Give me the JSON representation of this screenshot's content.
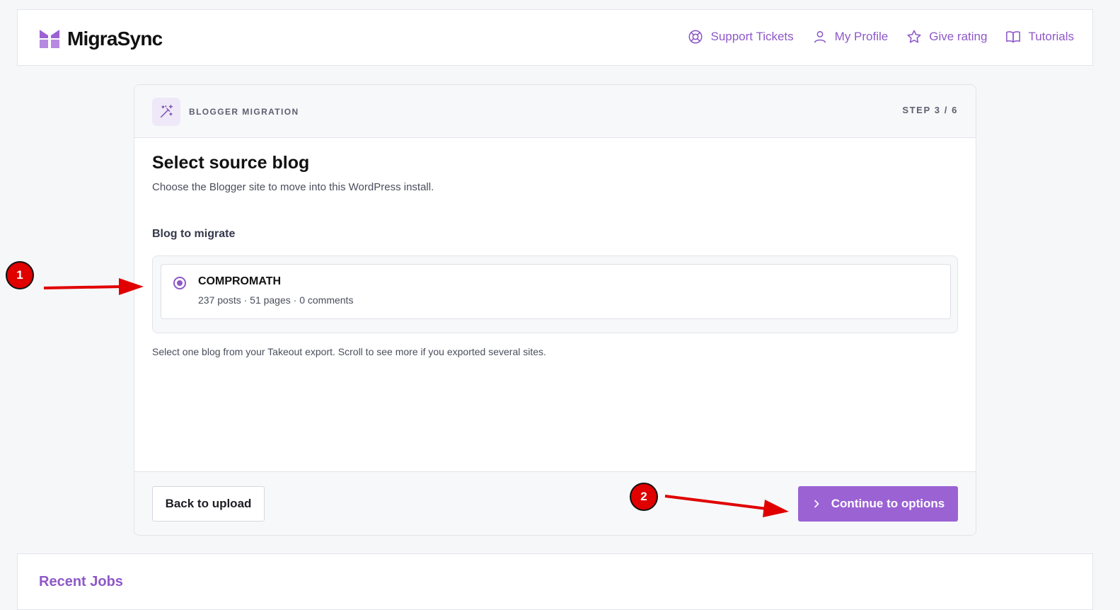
{
  "app": {
    "name": "MigraSync",
    "brand_color": "#8e58c8"
  },
  "nav": {
    "items": [
      {
        "label": "Support Tickets",
        "icon": "lifebuoy-icon"
      },
      {
        "label": "My Profile",
        "icon": "user-icon"
      },
      {
        "label": "Give rating",
        "icon": "star-icon"
      },
      {
        "label": "Tutorials",
        "icon": "book-icon"
      }
    ]
  },
  "wizard": {
    "section_label": "BLOGGER MIGRATION",
    "step": "STEP  3  /  6",
    "title": "Select source blog",
    "subtitle": "Choose the Blogger site to move into this WordPress install.",
    "field_label": "Blog to migrate",
    "blogs": [
      {
        "name": "COMPROMATH",
        "meta": "237 posts · 51 pages · 0 comments",
        "selected": true
      }
    ],
    "helper": "Select one blog from your Takeout export. Scroll to see more if you exported several sites.",
    "back_label": "Back to upload",
    "next_label": "Continue to options"
  },
  "recent": {
    "title": "Recent Jobs"
  },
  "annotations": [
    {
      "label": "1"
    },
    {
      "label": "2"
    }
  ]
}
